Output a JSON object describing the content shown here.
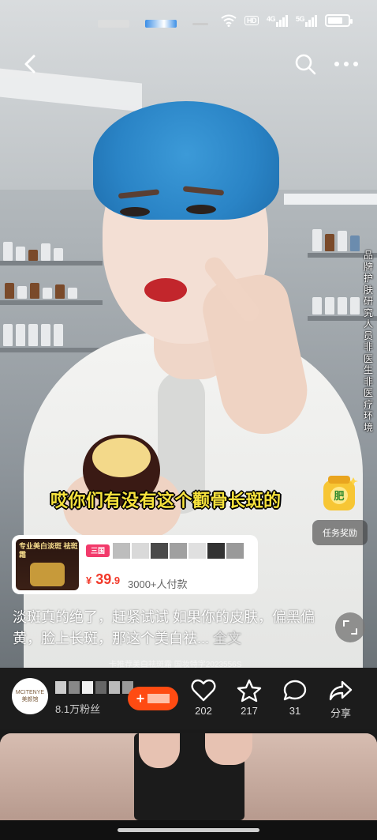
{
  "status_bar": {
    "icons": [
      "wifi-icon",
      "hd-icon",
      "4g-signal-icon",
      "5g-signal-icon",
      "battery-icon"
    ],
    "wifi_label": "",
    "hd_label": "HD",
    "signal_1_label": "4G",
    "signal_2_label": "5G"
  },
  "top_nav": {
    "back_icon": "chevron-left-icon",
    "search_icon": "search-icon",
    "more_icon": "more-dots-icon"
  },
  "video": {
    "side_caption": "品牌护肤研究人员非医生非医疗环境",
    "subtitle": "哎你们有没有这个颧骨长斑的",
    "license_text": "卡推荐美白祛斑霜 国妆特字2023556S"
  },
  "reward": {
    "icon_text": "肥",
    "label": "任务奖励"
  },
  "product": {
    "thumb_text": "专业美白淡斑 祛斑霜",
    "tag": "三国",
    "price_symbol": "¥",
    "price_int": "39",
    "price_dec": ".9",
    "paid_count": "3000+人付款"
  },
  "description": {
    "text": "淡斑真的绝了，赶紧试试 如果你的皮肤，偏黑偏黄，脸上长斑，那这个美白祛...",
    "more_label": "全文"
  },
  "author": {
    "avatar_text_top": "MCITENYE",
    "avatar_text_bottom": "美颜馆",
    "followers": "8.1万粉丝",
    "follow_plus": "+"
  },
  "actions": {
    "like_count": "202",
    "favorite_count": "217",
    "comment_count": "31",
    "share_label": "分享"
  },
  "colors": {
    "subtitle_yellow": "#f6e23c",
    "price_red": "#f23a2b",
    "follow_orange": "#ff4b12",
    "tag_pink": "#f23a6b",
    "cap_blue": "#2a84c6"
  }
}
